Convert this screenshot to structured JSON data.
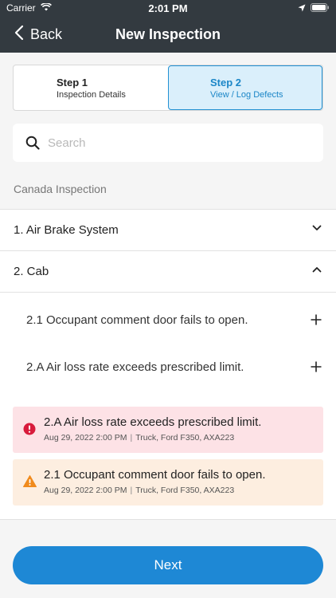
{
  "status_bar": {
    "carrier": "Carrier",
    "time": "2:01 PM"
  },
  "nav": {
    "back_label": "Back",
    "title": "New Inspection"
  },
  "steps": [
    {
      "number": "Step 1",
      "label": "Inspection Details",
      "active": false
    },
    {
      "number": "Step 2",
      "label": "View / Log Defects",
      "active": true
    }
  ],
  "search": {
    "placeholder": "Search",
    "value": ""
  },
  "section_title": "Canada Inspection",
  "categories": [
    {
      "label": "1. Air Brake System",
      "expanded": false
    },
    {
      "label": "2. Cab",
      "expanded": true,
      "defects": [
        {
          "label": "2.1 Occupant comment door fails to open."
        },
        {
          "label": "2.A Air loss rate exceeds prescribed limit."
        }
      ]
    }
  ],
  "logged_defects": [
    {
      "severity": "danger",
      "title": "2.A Air loss rate exceeds prescribed limit.",
      "date": "Aug 29, 2022 2:00 PM",
      "vehicle": "Truck, Ford F350, AXA223",
      "color": "#d81b3c"
    },
    {
      "severity": "warning",
      "title": "2.1 Occupant comment door fails to open.",
      "date": "Aug 29, 2022 2:00 PM",
      "vehicle": "Truck, Ford F350, AXA223",
      "color": "#f08a1c"
    }
  ],
  "next_label": "Next",
  "colors": {
    "header": "#333a40",
    "accent": "#1e88d5",
    "active_step_bg": "#daeffb"
  }
}
